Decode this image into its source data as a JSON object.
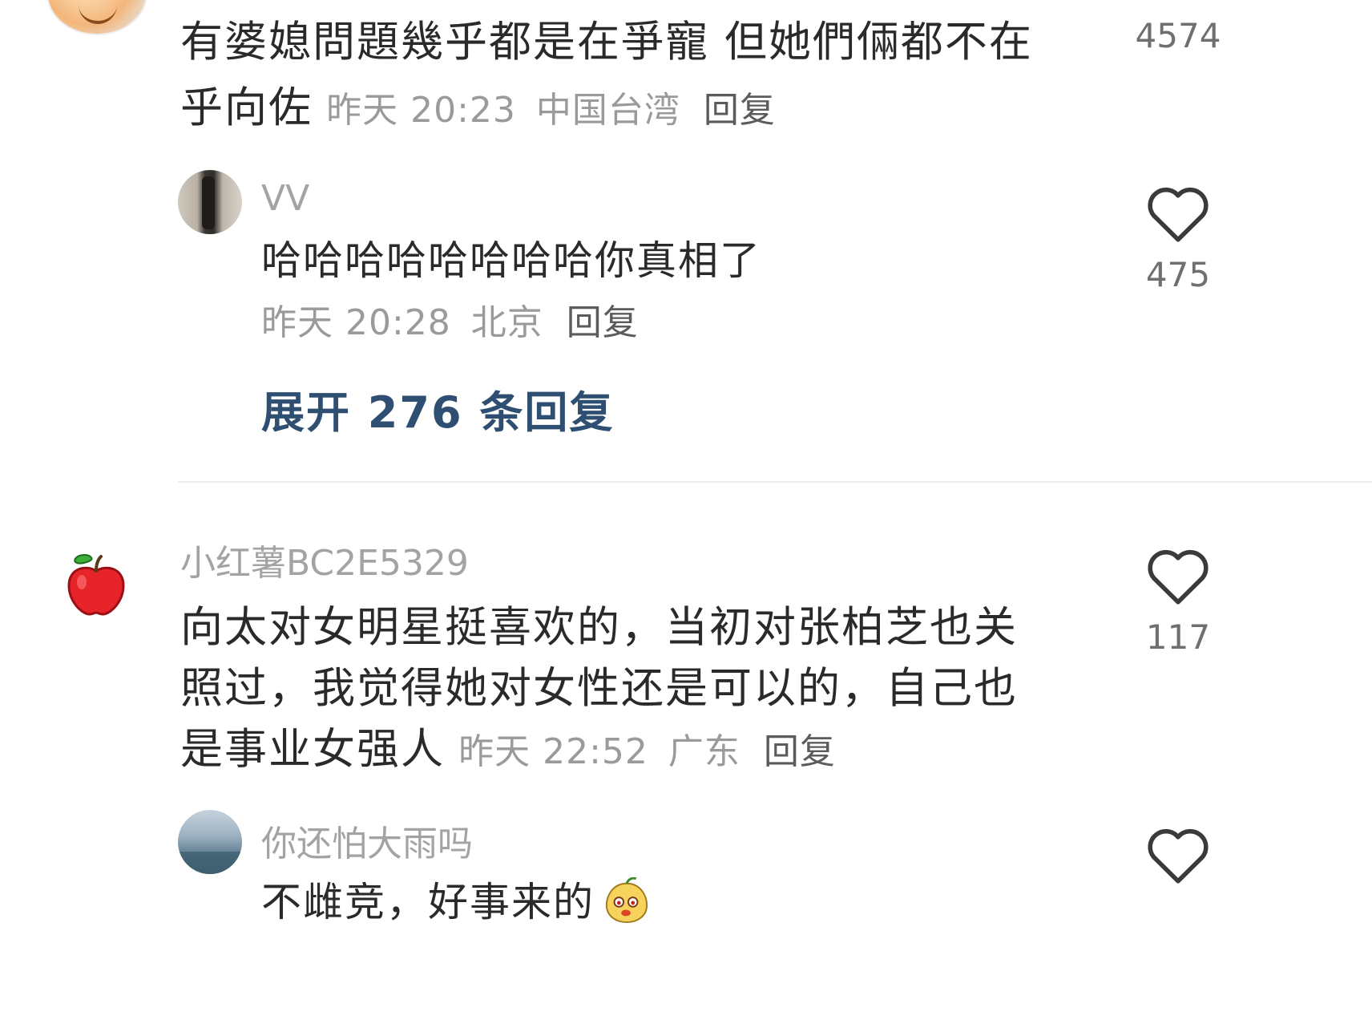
{
  "comments": [
    {
      "text_line1": "有婆媳問題幾乎都是在爭寵 但她們倆都不在",
      "text_line2": "乎向佐",
      "meta": {
        "time": "昨天 20:23",
        "location": "中国台湾",
        "reply_label": "回复"
      },
      "likes": "4574",
      "replies": [
        {
          "username": "VV",
          "text": "哈哈哈哈哈哈哈哈你真相了",
          "meta": {
            "time": "昨天 20:28",
            "location": "北京",
            "reply_label": "回复"
          },
          "likes": "475"
        }
      ],
      "expand_label": "展开 276 条回复"
    },
    {
      "username": "小红薯BC2E5329",
      "text_line1": "向太对女明星挺喜欢的，当初对张柏芝也关",
      "text_line2": "照过，我觉得她对女性还是可以的，自己也",
      "text_line3": "是事业女强人",
      "meta": {
        "time": "昨天 22:52",
        "location": "广东",
        "reply_label": "回复"
      },
      "likes": "117",
      "replies": [
        {
          "username": "你还怕大雨吗",
          "text": "不雌竞，好事来的"
        }
      ]
    }
  ],
  "icons": {
    "heart": "heart-outline-icon",
    "apple_avatar": "red-apple-icon",
    "emoji": "peach-face-emoji"
  },
  "colors": {
    "link_blue": "#2f4f72",
    "meta_gray": "#9a9a9a",
    "apple_red": "#e8242b"
  }
}
